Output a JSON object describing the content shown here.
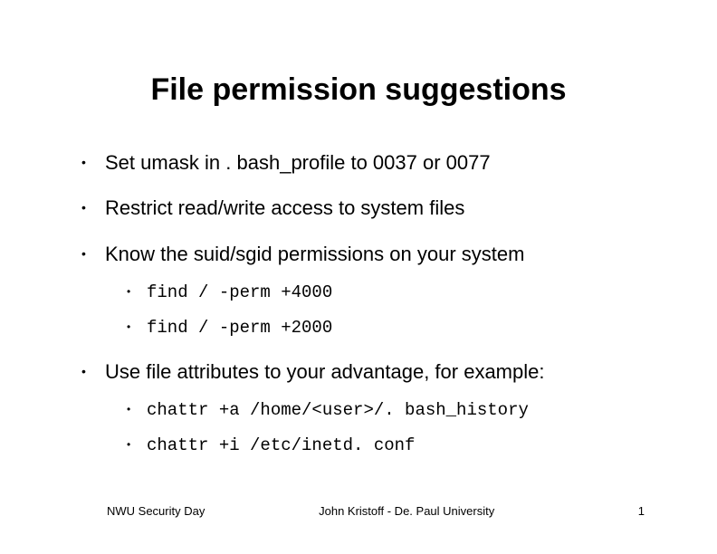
{
  "title": "File permission suggestions",
  "bullets": {
    "b0": "Set umask in . bash_profile to 0037 or 0077",
    "b1": "Restrict read/write access to system files",
    "b2": "Know the suid/sgid permissions on your system",
    "b2_sub0": "find / -perm +4000",
    "b2_sub1": "find / -perm +2000",
    "b3": "Use file attributes to your advantage, for example:",
    "b3_sub0": "chattr +a /home/<user>/. bash_history",
    "b3_sub1": "chattr +i /etc/inetd. conf"
  },
  "footer": {
    "left": "NWU Security Day",
    "center": "John Kristoff - De. Paul University",
    "page": "1"
  }
}
